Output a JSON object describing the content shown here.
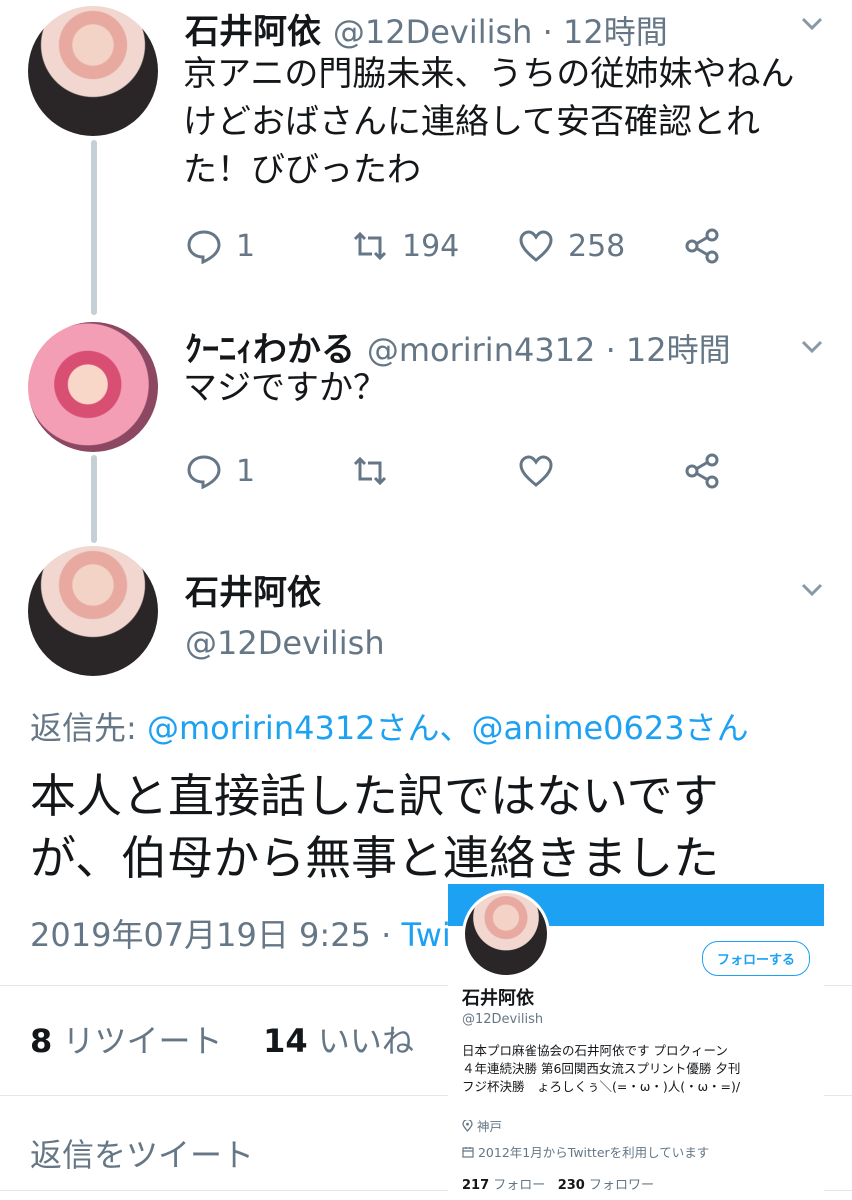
{
  "tweet1": {
    "name": "石井阿依",
    "handle": "@12Devilish · 12時間",
    "text_lines": [
      "京アニの門脇未来、うちの従姉妹やねん",
      "けどおばさんに連絡して安否確認とれ",
      "た！びびったわ"
    ],
    "replies": "1",
    "retweets": "194",
    "likes": "258"
  },
  "tweet2": {
    "name": "ｸｰﾆｨわかる",
    "handle": "@moririn4312 · 12時間",
    "text": "マジですか？",
    "replies": "1"
  },
  "main_tweet": {
    "name": "石井阿依",
    "handle": "@12Devilish",
    "reply_to_label": "返信先: ",
    "reply_to_mentions": "@moririn4312さん、@anime0623さん",
    "text_lines": [
      "本人と直接話した訳ではないです",
      "が、伯母から無事と連絡きました"
    ],
    "date": "2019年07月19日 9:25 · ",
    "source_partial": "Twi",
    "retweet_count": "8",
    "retweet_label": " リツイート",
    "like_count": "14",
    "like_label": " いいね",
    "reply_placeholder": "返信をツイート"
  },
  "profile_card": {
    "follow_label": "フォローする",
    "name": "石井阿依",
    "handle": "@12Devilish",
    "bio_lines": [
      "日本プロ麻雀協会の石井阿依です プロクィーン",
      "４年連続決勝 第6回関西女流スプリント優勝 夕刊",
      "フジ杯決勝　ょろしくぅ＼(=・ω・)人(・ω・=)/"
    ],
    "location": "神戸",
    "joined": "2012年1月からTwitterを利用しています",
    "following_count": "217",
    "following_label": " フォロー",
    "followers_count": "230",
    "followers_label": " フォロワー"
  },
  "colors": {
    "accent": "#1da1f2",
    "muted": "#657786",
    "thread_line": "#c4cfd6"
  },
  "icons": [
    "reply-icon",
    "retweet-icon",
    "like-icon",
    "share-icon",
    "chevron-down-icon",
    "location-icon",
    "calendar-icon"
  ]
}
